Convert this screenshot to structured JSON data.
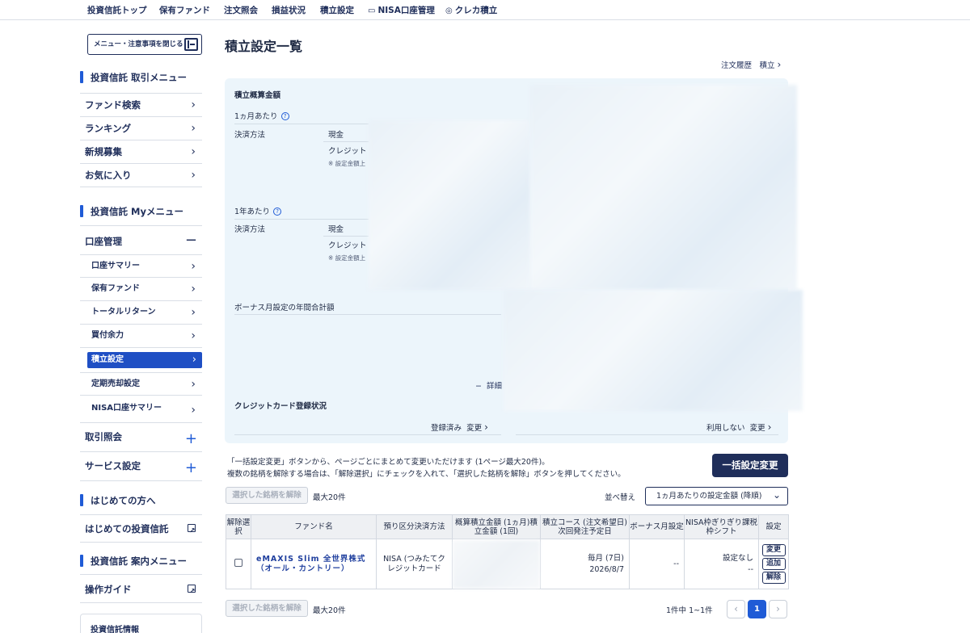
{
  "topnav": {
    "items": [
      "投資信託トップ",
      "保有ファンド",
      "注文照会",
      "損益状況",
      "積立設定",
      "NISA口座管理",
      "クレカ積立"
    ]
  },
  "sidebar": {
    "close_label": "メニュー・注意事項を閉じる",
    "trade_menu_title": "投資信託 取引メニュー",
    "trade_menu": [
      "ファンド検索",
      "ランキング",
      "新規募集",
      "お気に入り"
    ],
    "my_menu_title": "投資信託 Myメニュー",
    "account_label": "口座管理",
    "account_items": [
      "口座サマリー",
      "保有ファンド",
      "トータルリターン",
      "買付余力",
      "積立設定",
      "定期売却設定",
      "NISA口座サマリー"
    ],
    "inquiry_label": "取引照会",
    "service_label": "サービス設定",
    "beginner_title": "はじめての方へ",
    "beginner_link": "はじめての投資信託",
    "guide_title": "投資信託 案内メニュー",
    "guide_link": "操作ガイド",
    "info_box": "投資信託情報"
  },
  "main": {
    "title": "積立設定一覧",
    "history_link": "注文履歴　積立",
    "summary": {
      "title": "積立概算金額",
      "per_month": "1ヵ月あたり",
      "per_year": "1年あたり",
      "payment_method": "決済方法",
      "cash": "現金",
      "credit": "クレジット",
      "note": "※ 設定金額上",
      "bonus_title": "ボーナス月設定の年間合計額",
      "detail_link": "詳細",
      "card_title": "クレジットカード登録状況",
      "card_status_left": "登録済み",
      "card_change_left": "変更",
      "card_status_right": "利用しない",
      "card_change_right": "変更"
    },
    "desc_line1": "「一括設定変更」ボタンから、ページごとにまとめて変更いただけます (1ページ最大20件)。",
    "desc_line2": "複数の銘柄を解除する場合は、「解除選択」にチェックを入れて、「選択した銘柄を解除」ボタンを押してください。",
    "bulk_button": "一括設定変更",
    "unselect_button": "選択した銘柄を解除",
    "max_text": "最大20件",
    "sort_label": "並べ替え",
    "sort_value": "1ヵ月あたりの設定金額 (降順)"
  },
  "table": {
    "headers": {
      "unselect": "解除選択",
      "fund": "ファンド名",
      "account": "預り区分決済方法",
      "amount": "概算積立金額 (1ヵ月)積立金額 (1回)",
      "course": "積立コース (注文希望日)次回発注予定日",
      "bonus": "ボーナス月設定",
      "nisa": "NISA枠ぎりぎり課税枠シフト",
      "settings": "設定"
    },
    "rows": [
      {
        "fund_name": "eMAXIS Slim 全世界株式（オール・カントリー）",
        "account": "NISA (つみたてクレジットカード",
        "course": "毎月 (7日)",
        "next_date": "2026/8/7",
        "bonus": "--",
        "nisa_shift": "設定なし",
        "nisa_shift2": "--",
        "btn_change": "変更",
        "btn_add": "追加",
        "btn_cancel": "解除"
      }
    ]
  },
  "pager": {
    "summary": "1件中  1~1件",
    "prev": "‹",
    "current": "1",
    "next": "›"
  }
}
